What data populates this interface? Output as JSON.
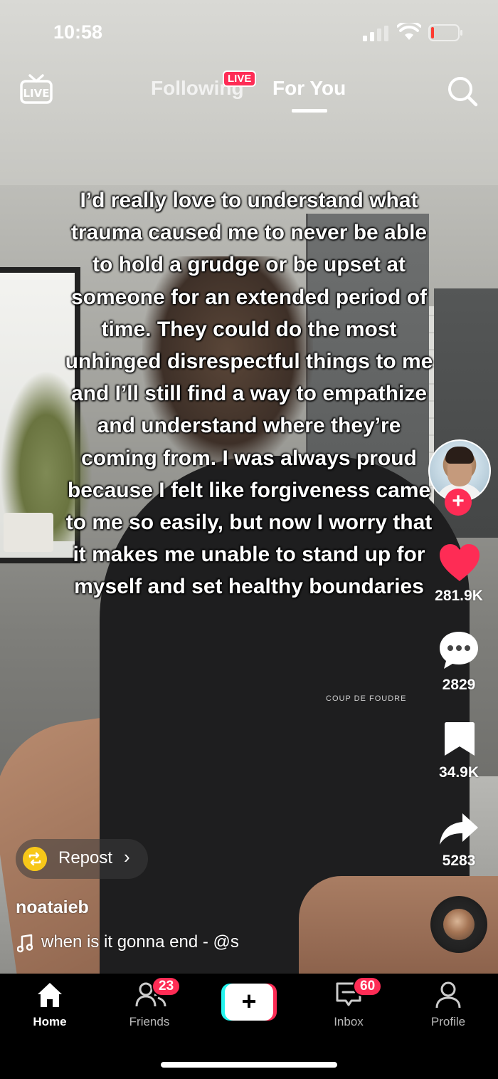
{
  "status_bar": {
    "time": "10:58"
  },
  "top_nav": {
    "live_icon_label": "LIVE",
    "tabs": [
      {
        "label": "Following",
        "badge": "LIVE",
        "active": false
      },
      {
        "label": "For You",
        "active": true
      }
    ]
  },
  "video": {
    "caption": "I’d really love to understand what trauma caused me to never be able to hold a grudge or be upset at someone for an extended period of time. They could do the most unhinged disrespectful things to me and I’ll still find a way to empathize and understand where they’re coming from. I was always proud because I felt like forgiveness came to me so easily, but now I worry that it makes me unable to stand up for myself and set healthy boundaries",
    "brand_mark": "COUP DE FOUDRE"
  },
  "right_rail": {
    "like_count": "281.9K",
    "comment_count": "2829",
    "save_count": "34.9K",
    "share_count": "5283",
    "like_color": "#fe2c55"
  },
  "overlay": {
    "repost_label": "Repost",
    "username": "noataieb",
    "sound": "when is it gonna end - @s"
  },
  "tab_bar": {
    "items": [
      {
        "label": "Home",
        "icon": "home-icon",
        "active": true
      },
      {
        "label": "Friends",
        "icon": "friends-icon",
        "badge": "23"
      },
      {
        "label": "",
        "icon": "plus-icon"
      },
      {
        "label": "Inbox",
        "icon": "inbox-icon",
        "badge": "60"
      },
      {
        "label": "Profile",
        "icon": "profile-icon"
      }
    ]
  },
  "colors": {
    "accent": "#fe2c55",
    "cyan": "#25f4ee",
    "repost": "#f7c719"
  }
}
